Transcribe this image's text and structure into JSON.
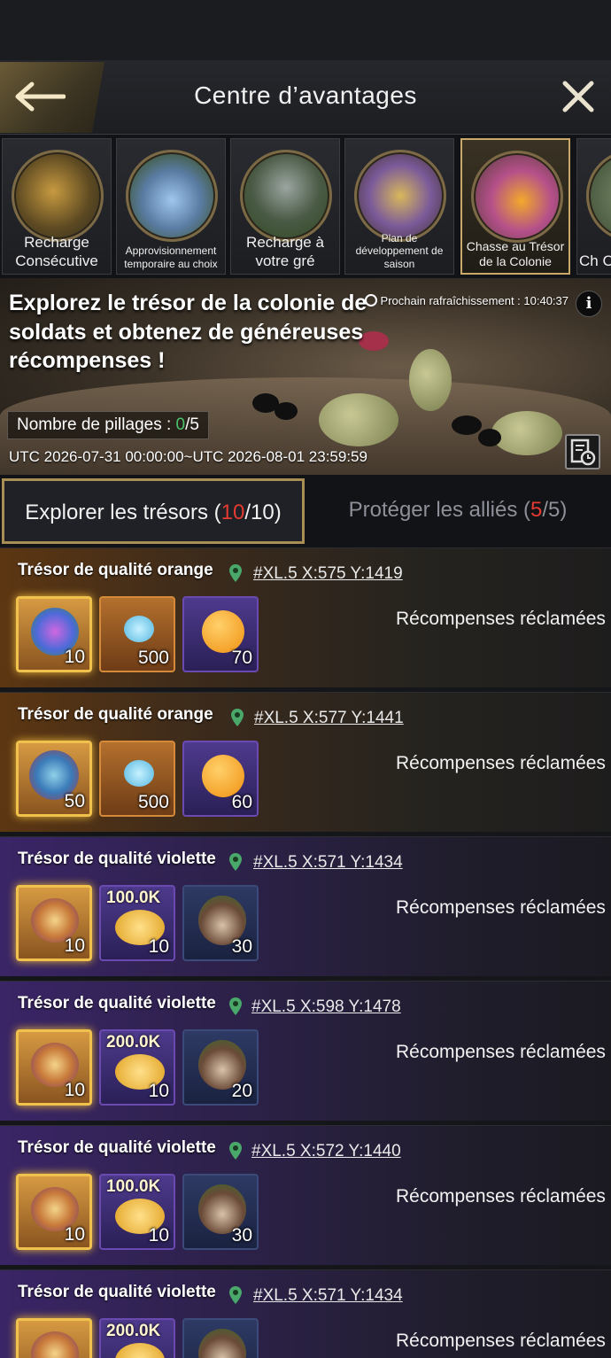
{
  "header": {
    "title": "Centre d’avantages",
    "back_icon": "arrow-left-icon",
    "close_icon": "close-icon"
  },
  "event_tabs": [
    {
      "label": "Recharge Consécutive",
      "icon": "ant-hunter-icon"
    },
    {
      "label": "Approvisionnement temporaire au choix",
      "icon": "crystal-shell-icon"
    },
    {
      "label": "Recharge à votre gré",
      "icon": "ant-on-rock-icon"
    },
    {
      "label": "Plan de développement de saison",
      "icon": "treasure-harp-icon"
    },
    {
      "label": "Chasse au Trésor de la Colonie",
      "icon": "ant-treasure-icon"
    },
    {
      "label": "Ch C",
      "icon": "partial-tab-icon"
    }
  ],
  "banner": {
    "headline": "Explorez le trésor de la colonie de soldats et obtenez de généreuses récompenses !",
    "refresh_label": "Prochain rafraîchissement : 10:40:37",
    "pillage_label": "Nombre de pillages : ",
    "pillage_current": "0",
    "pillage_total": "/5",
    "dates": "UTC 2026-07-31 00:00:00~UTC 2026-08-01 23:59:59"
  },
  "segments": {
    "explore": {
      "label": "Explorer les trésors (",
      "current": "10",
      "rest": "/10)"
    },
    "protect": {
      "label": "Protéger les alliés (",
      "current": "5",
      "rest": "/5)"
    }
  },
  "colors": {
    "orange_card": "#5c3612",
    "violet_card": "#3a2566",
    "accent_gold": "#c9a96a",
    "count_red": "#e23a30",
    "count_green": "#49c46a"
  },
  "treasures": [
    {
      "name": "Trésor de qualité orange",
      "coords": "#XL.5  X:575  Y:1419",
      "status": "Récompenses réclamées",
      "rewards": [
        {
          "qty": "10",
          "icon": "gem-cluster-icon"
        },
        {
          "qty": "500",
          "icon": "blue-crystal-icon"
        },
        {
          "qty": "70",
          "icon": "orange-fruit-icon"
        }
      ]
    },
    {
      "name": "Trésor de qualité orange",
      "coords": "#XL.5  X:577  Y:1441",
      "status": "Récompenses réclamées",
      "rewards": [
        {
          "qty": "50",
          "icon": "shell-leaf-icon"
        },
        {
          "qty": "500",
          "icon": "blue-crystal-icon"
        },
        {
          "qty": "60",
          "icon": "orange-fruit-icon"
        }
      ]
    },
    {
      "name": "Trésor de qualité violette",
      "coords": "#XL.5  X:571  Y:1434",
      "status": "Récompenses réclamées",
      "rewards": [
        {
          "qty": "10",
          "icon": "treasure-pile-icon"
        },
        {
          "qty": "10",
          "amount": "100.0K",
          "icon": "honeydew-icon"
        },
        {
          "qty": "30",
          "icon": "mushroom-shell-icon"
        }
      ]
    },
    {
      "name": "Trésor de qualité violette",
      "coords": "#XL.5  X:598  Y:1478",
      "status": "Récompenses réclamées",
      "rewards": [
        {
          "qty": "10",
          "icon": "treasure-pile-icon"
        },
        {
          "qty": "10",
          "amount": "200.0K",
          "icon": "honeydew-icon"
        },
        {
          "qty": "20",
          "icon": "mushroom-shell-icon"
        }
      ]
    },
    {
      "name": "Trésor de qualité violette",
      "coords": "#XL.5  X:572  Y:1440",
      "status": "Récompenses réclamées",
      "rewards": [
        {
          "qty": "10",
          "icon": "treasure-pile-icon"
        },
        {
          "qty": "10",
          "amount": "100.0K",
          "icon": "honeydew-icon"
        },
        {
          "qty": "30",
          "icon": "mushroom-shell-icon"
        }
      ]
    },
    {
      "name": "Trésor de qualité violette",
      "coords": "#XL.5  X:571  Y:1434",
      "status": "Récompenses réclamées",
      "rewards": [
        {
          "qty": "",
          "icon": "treasure-pile-icon"
        },
        {
          "qty": "",
          "amount": "200.0K",
          "icon": "honeydew-icon"
        },
        {
          "qty": "",
          "icon": "mushroom-shell-icon"
        }
      ]
    }
  ]
}
